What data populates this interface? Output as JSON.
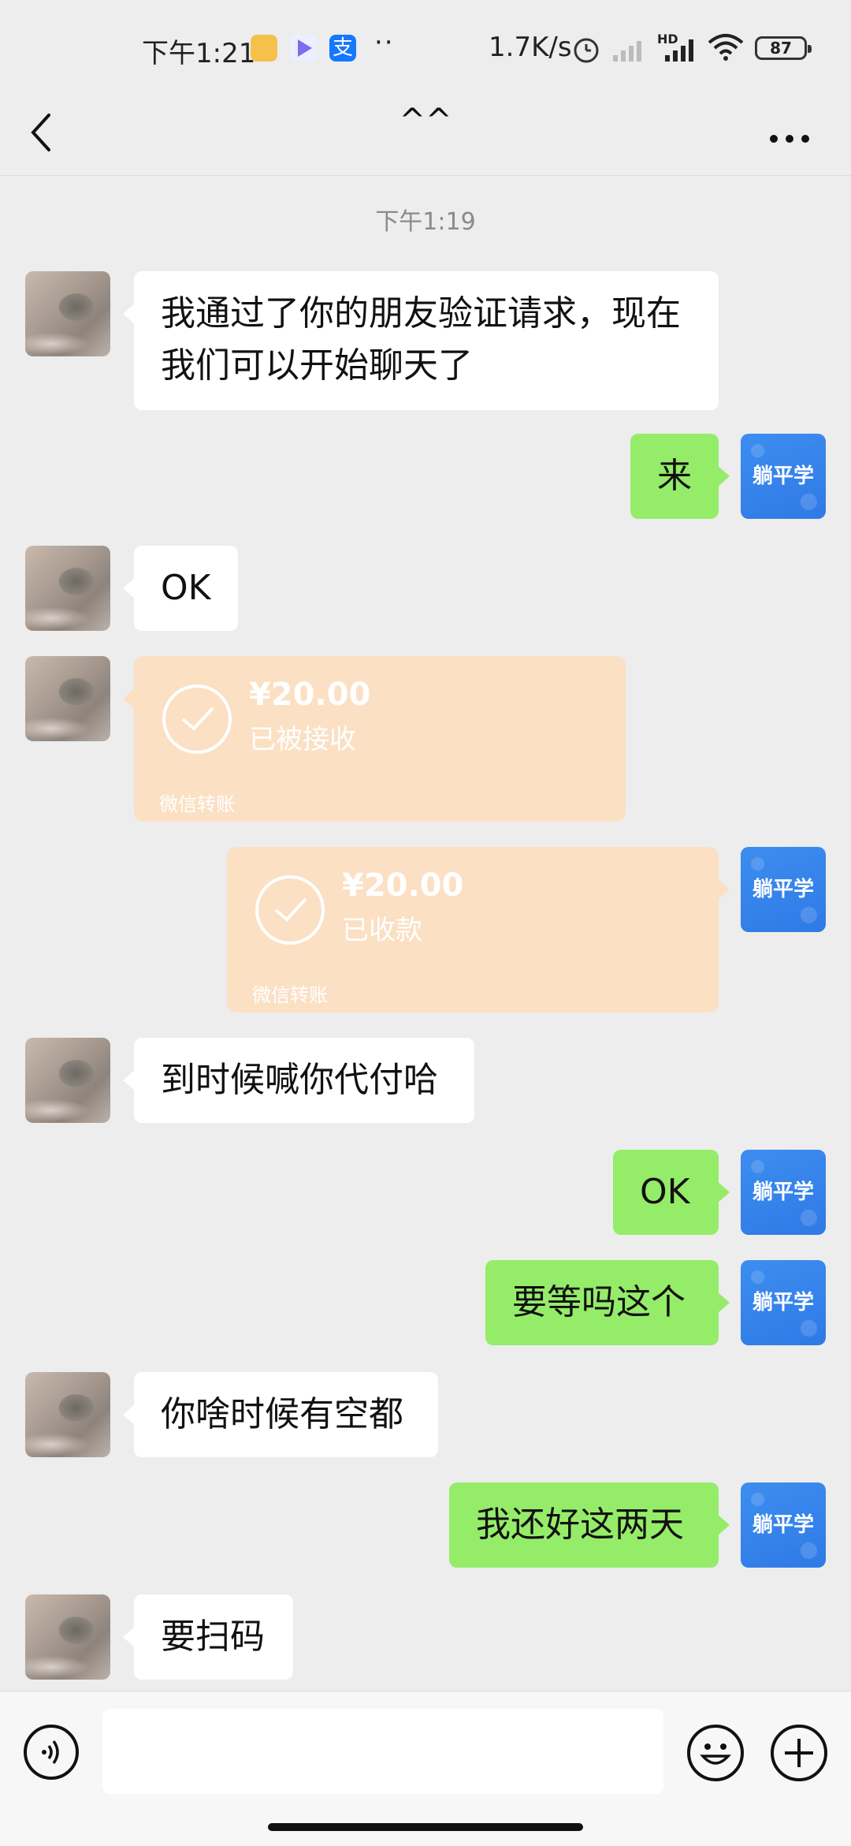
{
  "status_bar": {
    "time": "下午1:21",
    "dots": "··",
    "network_speed": "1.7K/s",
    "battery": "87",
    "signal_label": "HD"
  },
  "nav": {
    "title": "^^",
    "back_icon": "chevron-left-icon",
    "more_icon": "more-dots-icon"
  },
  "chat": {
    "timestamp": "下午1:19",
    "my_avatar_label": "躺平学",
    "messages": [
      {
        "side": "in",
        "text": "我通过了你的朋友验证请求，现在我们可以开始聊天了"
      },
      {
        "side": "out",
        "text": "来"
      },
      {
        "side": "in",
        "text": "OK"
      },
      {
        "side": "in",
        "type": "transfer",
        "amount": "¥20.00",
        "status": "已被接收",
        "footer": "微信转账"
      },
      {
        "side": "out",
        "type": "transfer",
        "amount": "¥20.00",
        "status": "已收款",
        "footer": "微信转账"
      },
      {
        "side": "in",
        "text": "到时候喊你代付哈"
      },
      {
        "side": "out",
        "text": "OK"
      },
      {
        "side": "out",
        "text": "要等吗这个"
      },
      {
        "side": "in",
        "text": "你啥时候有空都"
      },
      {
        "side": "out",
        "text": "我还好这两天"
      },
      {
        "side": "in",
        "text": "要扫码"
      }
    ]
  },
  "input_bar": {
    "voice_icon": "voice-icon",
    "emoji_icon": "emoji-icon",
    "plus_icon": "plus-icon",
    "placeholder": ""
  },
  "colors": {
    "background": "#ededed",
    "out_bubble": "#95ec69",
    "in_bubble": "#ffffff",
    "transfer": "#fbe0c4",
    "avatar_blue": "#3d8df0"
  }
}
